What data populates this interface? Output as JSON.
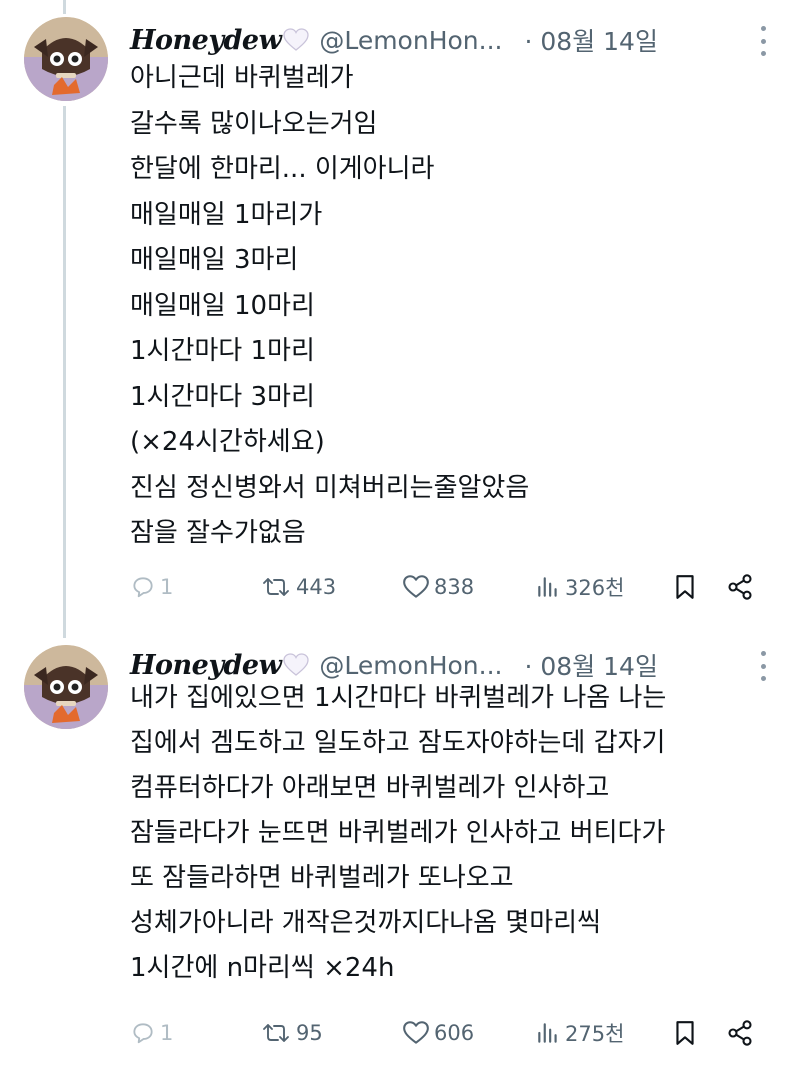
{
  "tweets": [
    {
      "display_name": "Honeydew",
      "handle": "@LemonHon...",
      "date": "· 08월 14일",
      "lines": [
        "아니근데 바퀴벌레가",
        "갈수록 많이나오는거임",
        "한달에 한마리... 이게아니라",
        "매일매일 1마리가",
        "매일매일 3마리",
        "매일매일 10마리",
        "1시간마다 1마리",
        "1시간마다 3마리",
        "(×24시간하세요)",
        "진심 정신병와서 미쳐버리는줄알았음",
        "잠을 잘수가없음"
      ],
      "replies": "1",
      "retweets": "443",
      "likes": "838",
      "views": "326천"
    },
    {
      "display_name": "Honeydew",
      "handle": "@LemonHon...",
      "date": "· 08월 14일",
      "lines": [
        "내가 집에있으면 1시간마다 바퀴벌레가 나옴 나는",
        "집에서 겜도하고 일도하고 잠도자야하는데 갑자기",
        "컴퓨터하다가 아래보면 바퀴벌레가 인사하고",
        "잠들라다가 눈뜨면 바퀴벌레가 인사하고 버티다가",
        "또 잠들라하면 바퀴벌레가 또나오고",
        "성체가아니라 개작은것까지다나옴 몇마리씩",
        "1시간에 n마리씩 ×24h"
      ],
      "replies": "1",
      "retweets": "95",
      "likes": "606",
      "views": "275천"
    }
  ],
  "icons": {
    "reply": "reply-icon",
    "retweet": "retweet-icon",
    "like": "heart-outline-icon",
    "views": "views-bar-chart-icon",
    "bookmark": "bookmark-icon",
    "share": "share-icon",
    "more": "more-vertical-icon",
    "name_emoji": "white-heart-emoji-icon"
  },
  "colors": {
    "text": "#0f1419",
    "secondary": "#536471",
    "thread_line": "#cfd9de",
    "reply_icon": "#b0bcc4"
  }
}
